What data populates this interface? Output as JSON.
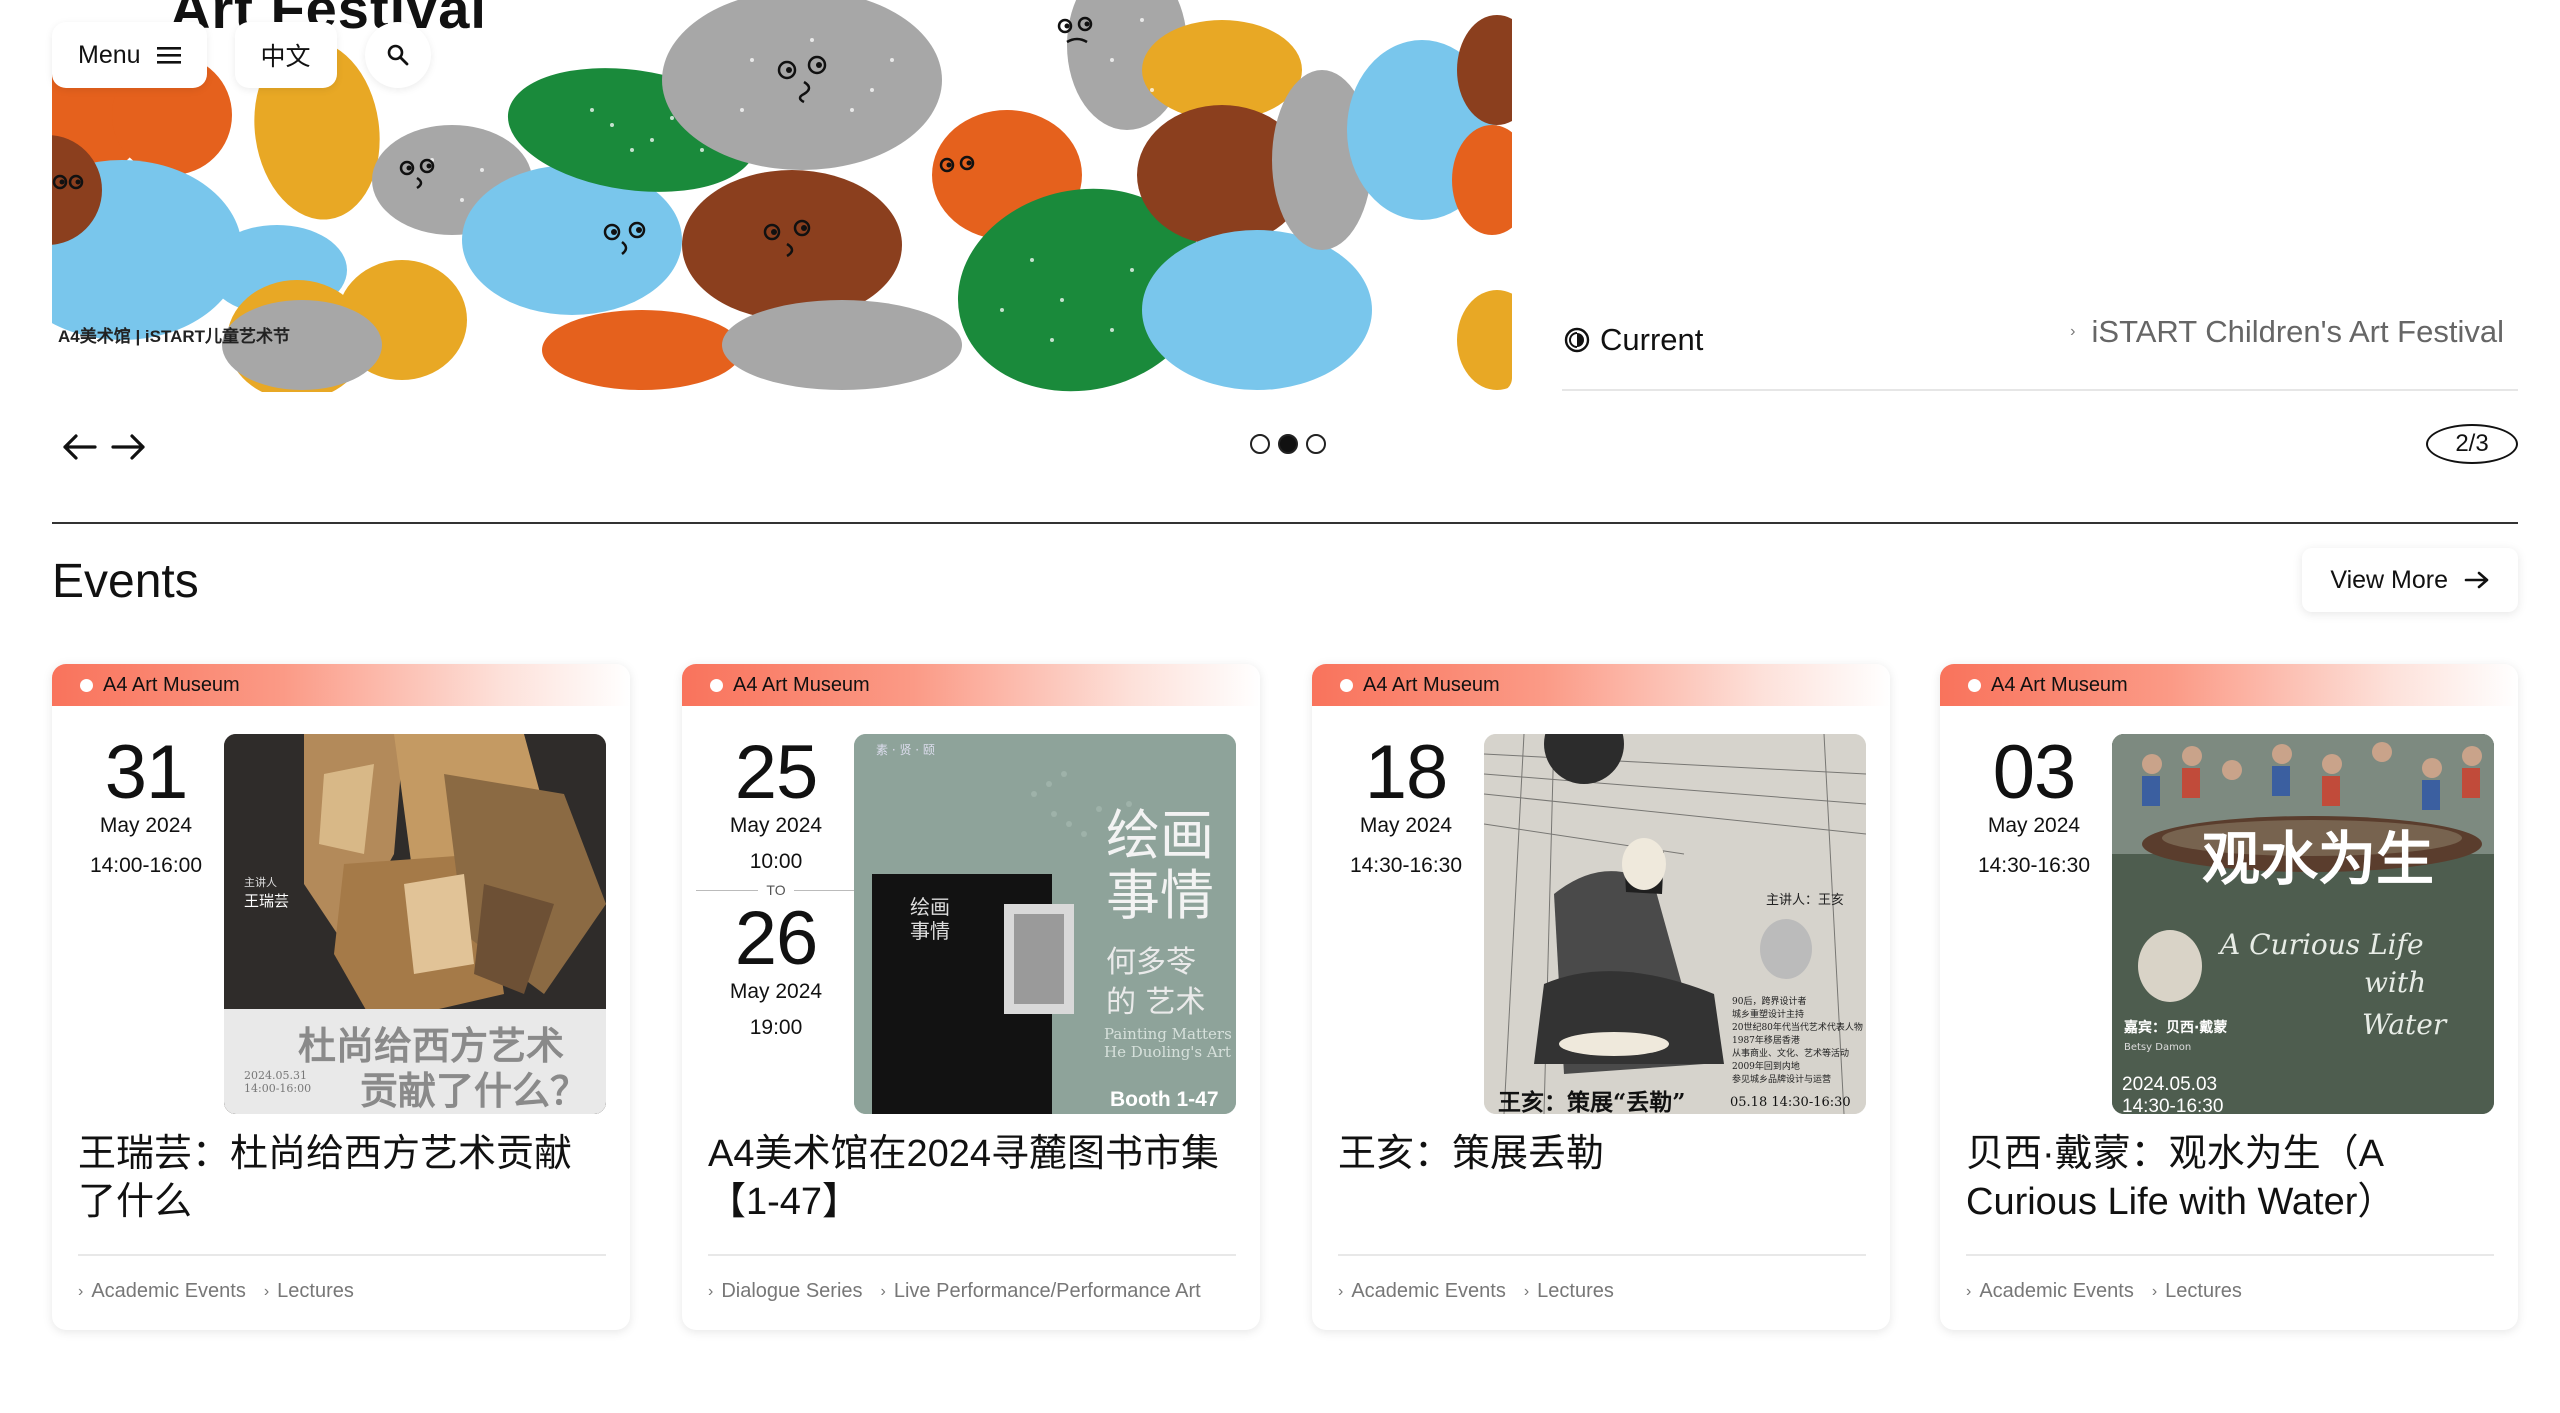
{
  "header": {
    "menu_label": "Menu",
    "language_label": "中文"
  },
  "hero": {
    "banner_title": "Art Festival",
    "banner_logo_left": "A4美术馆 | iSTART儿童艺术节",
    "current_label": "Current",
    "festival_link": "iSTART Children's Art Festival",
    "page_indicator": "2/3",
    "active_slide": 2,
    "slide_count": 3
  },
  "events": {
    "title": "Events",
    "view_more_label": "View More",
    "cards": [
      {
        "venue": "A4 Art Museum",
        "day": "31",
        "month": "May 2024",
        "time": "14:00-16:00",
        "title": "王瑞芸：杜尚给西方艺术贡献了什么",
        "poster_text": "杜尚给西方艺术贡献了什么？",
        "poster_speaker": "王瑞芸",
        "poster_date": "2024.05.31 14:00-16:00",
        "categories": [
          "Academic Events",
          "Lectures"
        ]
      },
      {
        "venue": "A4 Art Museum",
        "day": "25",
        "month": "May 2024",
        "time": "10:00",
        "to_label": "TO",
        "end_day": "26",
        "end_month": "May 2024",
        "end_time": "19:00",
        "title": "A4美术馆在2024寻麓图书市集【1-47】",
        "poster_text": "绘画事情",
        "poster_sub": "何多苓的艺术",
        "poster_booth": "Booth 1-47",
        "categories": [
          "Dialogue Series",
          "Live Performance/Performance Art"
        ]
      },
      {
        "venue": "A4 Art Museum",
        "day": "18",
        "month": "May 2024",
        "time": "14:30-16:30",
        "title": "王亥：策展丢勒",
        "poster_text": "王亥：策展“丢勒”",
        "poster_date": "05.18 14:30-16:30",
        "poster_speaker": "主讲人：王亥",
        "categories": [
          "Academic Events",
          "Lectures"
        ]
      },
      {
        "venue": "A4 Art Museum",
        "day": "03",
        "month": "May 2024",
        "time": "14:30-16:30",
        "title": "贝西·戴蒙：观水为生（A Curious Life with Water）",
        "poster_text": "观水为生",
        "poster_en": "A Curious Life with Water",
        "poster_guest": "嘉宾：贝西·戴蒙",
        "poster_guest_en": "Betsy Damon",
        "poster_date": "2024.05.03",
        "poster_time": "14:30-16:30",
        "categories": [
          "Academic Events",
          "Lectures"
        ]
      }
    ]
  },
  "colors": {
    "tag_gradient_start": "#f9735c",
    "accent_text": "#111111",
    "muted_text": "#777777"
  }
}
